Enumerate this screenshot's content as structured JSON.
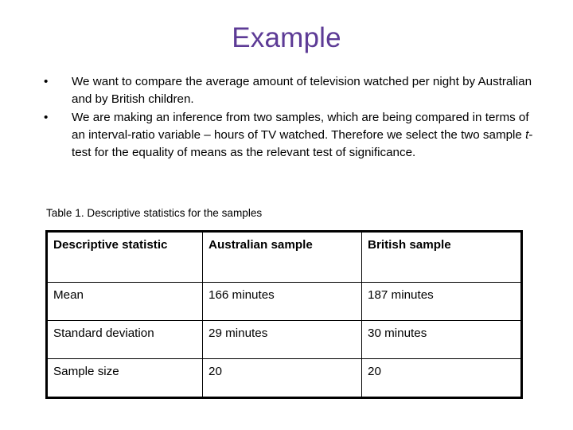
{
  "slide": {
    "title": "Example",
    "bullet_marker": "•",
    "bullets": [
      {
        "text": "We want to compare the average amount of television watched per night by Australian and by British children."
      },
      {
        "text_before_italic": "We are making an inference from two samples, which are being compared in terms of an interval-ratio variable – hours of TV watched. Therefore we select the two sample ",
        "italic": "t",
        "text_after_italic": "-test for the equality of means as the relevant test of significance."
      }
    ],
    "table_caption": "Table 1. Descriptive statistics for the samples",
    "table": {
      "headers": [
        "Descriptive statistic",
        "Australian sample",
        "British sample"
      ],
      "rows": [
        [
          "Mean",
          "166 minutes",
          "187 minutes"
        ],
        [
          "Standard deviation",
          "29 minutes",
          "30 minutes"
        ],
        [
          "Sample size",
          "20",
          "20"
        ]
      ]
    },
    "colors": {
      "title": "#5d3b96",
      "body_text": "#000000",
      "background": "#ffffff",
      "table_border": "#000000"
    }
  }
}
